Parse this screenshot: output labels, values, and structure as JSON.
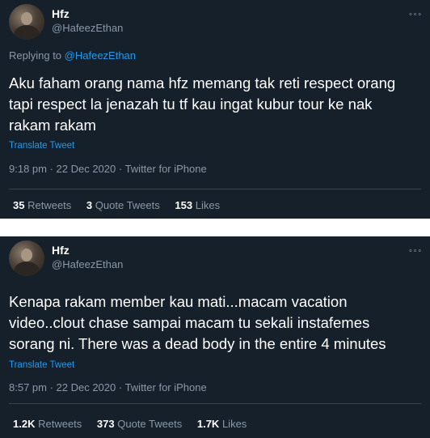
{
  "tweets": [
    {
      "name": "Hfz",
      "handle": "@HafeezEthan",
      "more": "∘∘∘",
      "replying_prefix": "Replying to ",
      "replying_to": "@HafeezEthan",
      "text": "Aku faham orang nama hfz memang tak reti respect orang tapi respect la jenazah tu tf kau ingat kubur tour ke nak rakam rakam",
      "translate": "Translate Tweet",
      "meta": "9:18 pm · 22 Dec 2020 · Twitter for iPhone",
      "retweets": {
        "count": "35",
        "label": "Retweets"
      },
      "quotes": {
        "count": "3",
        "label": "Quote Tweets"
      },
      "likes": {
        "count": "153",
        "label": "Likes"
      }
    },
    {
      "name": "Hfz",
      "handle": "@HafeezEthan",
      "more": "∘∘∘",
      "text": "Kenapa rakam member kau mati...macam vacation video..clout chase sampai macam tu sekali instafemes sorang ni. There was a dead body in the entire 4 minutes",
      "translate": "Translate Tweet",
      "meta": "8:57 pm · 22 Dec 2020 · Twitter for iPhone",
      "retweets": {
        "count": "1.2K",
        "label": "Retweets"
      },
      "quotes": {
        "count": "373",
        "label": "Quote Tweets"
      },
      "likes": {
        "count": "1.7K",
        "label": "Likes"
      }
    }
  ],
  "colors": {
    "background": "#15202b",
    "secondary_text": "#8b98a5",
    "link": "#1d9bf0",
    "divider": "#38444d"
  }
}
